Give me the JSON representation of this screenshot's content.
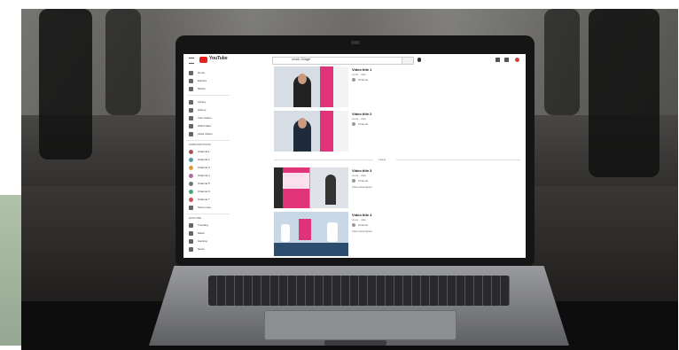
{
  "youtube": {
    "brand": "YouTube",
    "search_query": "cicek 20age",
    "sidebar": {
      "main": [
        {
          "label": "Home"
        },
        {
          "label": "Explore"
        },
        {
          "label": "Shorts"
        }
      ],
      "library": [
        {
          "label": "Library"
        },
        {
          "label": "History"
        },
        {
          "label": "Your videos"
        },
        {
          "label": "Watch later"
        },
        {
          "label": "Liked videos"
        }
      ],
      "subs_heading": "SUBSCRIPTIONS",
      "subscriptions": [
        {
          "label": "Channel 1"
        },
        {
          "label": "Channel 2"
        },
        {
          "label": "Channel 3"
        },
        {
          "label": "Channel 4"
        },
        {
          "label": "Channel 5"
        },
        {
          "label": "Channel 6"
        },
        {
          "label": "Channel 7"
        },
        {
          "label": "Show more"
        }
      ],
      "explore_heading": "EXPLORE",
      "explore": [
        {
          "label": "Trending"
        },
        {
          "label": "Music"
        },
        {
          "label": "Gaming"
        },
        {
          "label": "News"
        }
      ]
    },
    "results": [
      {
        "title": "Video title 1",
        "meta": "views · date",
        "channel": "Channel",
        "desc": ""
      },
      {
        "title": "Video title 2",
        "meta": "views · date",
        "channel": "Channel",
        "desc": ""
      },
      {
        "title": "Video title 3",
        "meta": "views · date",
        "channel": "Channel",
        "desc": "Video description"
      },
      {
        "title": "Video title 4",
        "meta": "views · date",
        "channel": "Channel",
        "desc": "Video description"
      }
    ],
    "separator_label": "Latest"
  },
  "colors": {
    "youtube_red": "#e62117",
    "thumb_pink": "#e0337a",
    "thumb_blue": "#c9d8e6"
  }
}
